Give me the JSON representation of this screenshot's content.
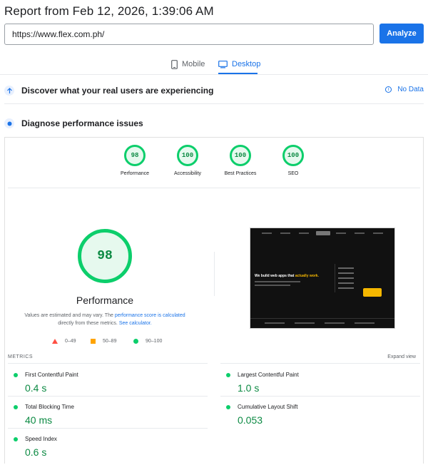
{
  "header": {
    "title": "Report from Feb 12, 2026, 1:39:06 AM"
  },
  "url_bar": {
    "value": "https://www.flex.com.ph/",
    "analyze_label": "Analyze"
  },
  "tabs": [
    {
      "label": "Mobile",
      "icon": "phone-icon",
      "active": false
    },
    {
      "label": "Desktop",
      "icon": "monitor-icon",
      "active": true
    }
  ],
  "sections": {
    "real_users": {
      "label": "Discover what your real users are experiencing",
      "no_data": "No Data"
    },
    "diagnose": {
      "label": "Diagnose performance issues"
    }
  },
  "scores": [
    {
      "value": "98",
      "label": "Performance"
    },
    {
      "value": "100",
      "label": "Accessibility"
    },
    {
      "value": "100",
      "label": "Best Practices"
    },
    {
      "value": "100",
      "label": "SEO"
    }
  ],
  "performance": {
    "score": "98",
    "label": "Performance",
    "note_prefix": "Values are estimated and may vary. The ",
    "note_link1": "performance score is calculated",
    "note_mid": " directly from these metrics. ",
    "note_link2": "See calculator."
  },
  "legend": [
    {
      "range": "0–49",
      "color": "#ff4e42"
    },
    {
      "range": "50–89",
      "color": "#ffa400"
    },
    {
      "range": "90–100",
      "color": "#0cce6b"
    }
  ],
  "screenshot": {
    "headline_main": "We build web apps that ",
    "headline_accent": "actually work."
  },
  "metrics_header": {
    "title": "METRICS",
    "expand": "Expand view"
  },
  "metrics": [
    {
      "name": "First Contentful Paint",
      "value": "0.4 s"
    },
    {
      "name": "Largest Contentful Paint",
      "value": "1.0 s"
    },
    {
      "name": "Total Blocking Time",
      "value": "40 ms"
    },
    {
      "name": "Cumulative Layout Shift",
      "value": "0.053"
    },
    {
      "name": "Speed Index",
      "value": "0.6 s"
    }
  ],
  "colors": {
    "accent": "#1a73e8",
    "pass": "#0cce6b",
    "pass_text": "#0c8a43"
  }
}
